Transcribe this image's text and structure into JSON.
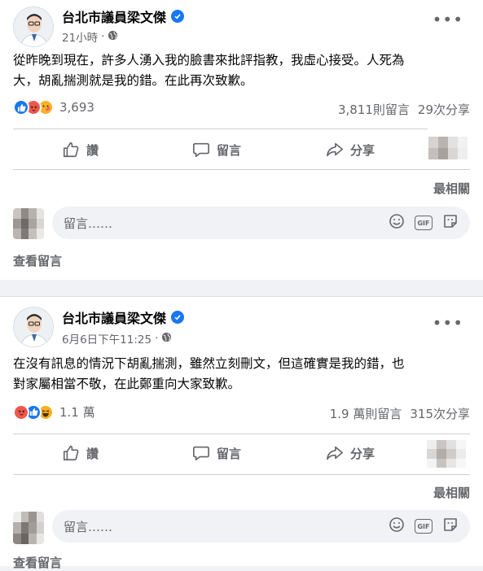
{
  "posts": [
    {
      "author": "台北市議員梁文傑",
      "time": "21小時",
      "body_lines": [
        "從昨晚到現在，許多人湧入我的臉書來批評指教，我虛心接受。人死為",
        "大，胡亂揣測就是我的錯。在此再次致歉。"
      ],
      "reaction_count": "3,693",
      "comments_count": "3,811則留言",
      "shares_count": "29次分享",
      "reactions": [
        "like-icon",
        "angry-icon",
        "care-icon"
      ]
    },
    {
      "author": "台北市議員梁文傑",
      "time": "6月6日下午11:25",
      "body_lines": [
        "在沒有訊息的情況下胡亂揣測，雖然立刻刪文，但這確實是我的錯，也",
        "對家屬相當不敬，在此鄭重向大家致歉。"
      ],
      "reaction_count": "1.1 萬",
      "comments_count": "1.9 萬則留言",
      "shares_count": "315次分享",
      "reactions": [
        "angry-icon",
        "like-icon",
        "haha-icon"
      ]
    }
  ],
  "actions": {
    "like": "讚",
    "comment": "留言",
    "share": "分享"
  },
  "sort_label": "最相關",
  "comment_placeholder": "留言……",
  "gif_label": "GIF",
  "see_comments": "查看留言",
  "more_glyph": "•••",
  "dot_separator": "·",
  "colors": {
    "facebook_blue": "#1877f2",
    "secondary_text": "#65676b",
    "angry": "#f0584f",
    "care": "#f7b125"
  }
}
